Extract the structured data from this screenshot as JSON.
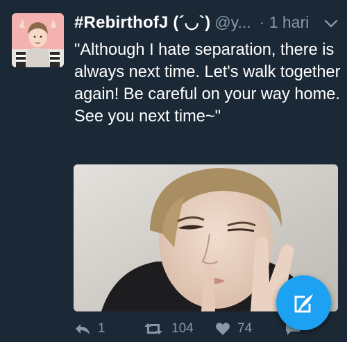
{
  "tweet": {
    "display_name": "#RebirthofJ (´◡`)",
    "handle": "@y...",
    "time": "· 1 hari",
    "text": "\"Although I hate separation, there is always next time. Let's walk together again! Be careful on your way home. See you next time~\""
  },
  "actions": {
    "reply_count": "1",
    "retweet_count": "104",
    "like_count": "74"
  },
  "icons": {
    "caret": "chevron-down-icon",
    "reply": "reply-icon",
    "retweet": "retweet-icon",
    "like": "heart-icon",
    "dm": "message-icon",
    "compose": "compose-tweet-icon"
  },
  "colors": {
    "background": "#1b2836",
    "muted": "#8899a6",
    "accent": "#1da1f2",
    "text": "#ffffff"
  }
}
